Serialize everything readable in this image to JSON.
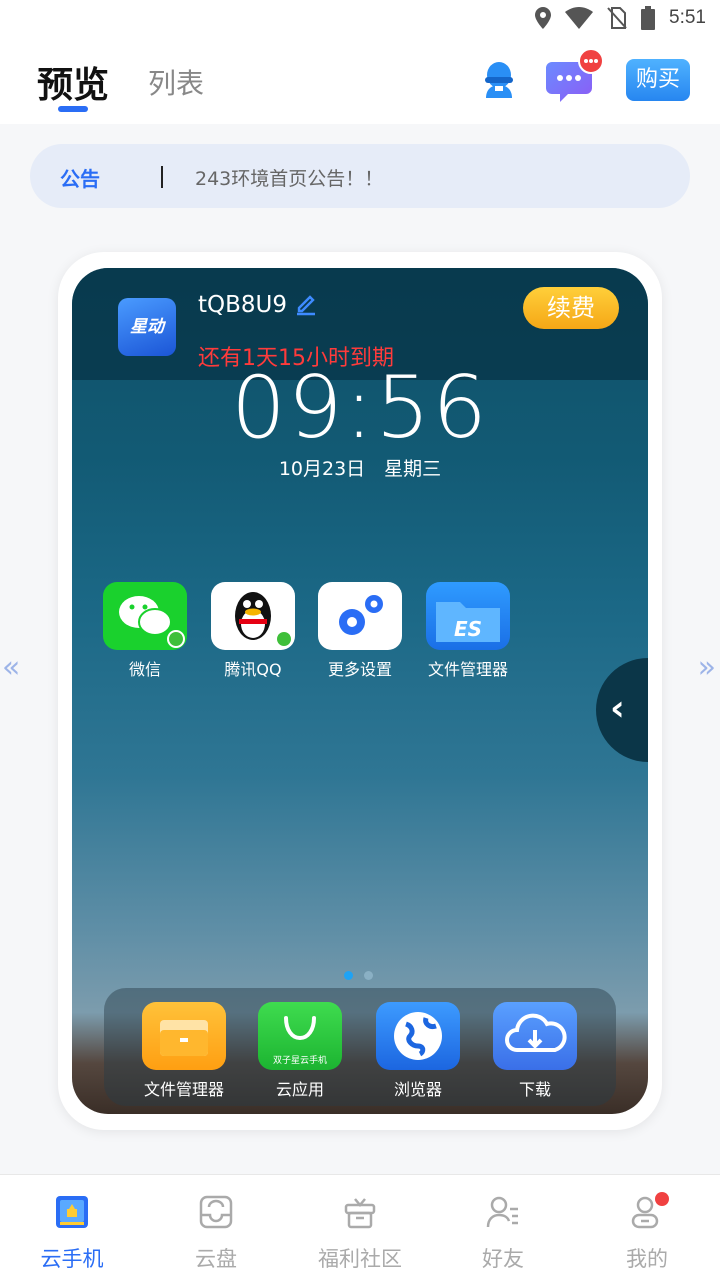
{
  "status_bar": {
    "time": "5:51",
    "icons": [
      "location-icon",
      "wifi-icon",
      "no-sim-icon",
      "battery-icon"
    ]
  },
  "header": {
    "tabs": [
      {
        "label": "预览",
        "active": true
      },
      {
        "label": "列表",
        "active": false
      }
    ],
    "buy_label": "购买"
  },
  "notice": {
    "label": "公告",
    "text": "243环境首页公告！！"
  },
  "device": {
    "logo_text": "星动",
    "name": "tQB8U9",
    "renew_label": "续费",
    "expiry": "还有1天15小时到期",
    "clock": "09:56",
    "date": "10月23日　星期三"
  },
  "home_apps": [
    {
      "label": "微信",
      "icon": "wechat-icon"
    },
    {
      "label": "腾讯QQ",
      "icon": "qq-icon"
    },
    {
      "label": "更多设置",
      "icon": "settings-gears-icon"
    },
    {
      "label": "文件管理器",
      "icon": "es-file-icon"
    }
  ],
  "dock_apps": [
    {
      "label": "文件管理器",
      "icon": "folder-icon"
    },
    {
      "label": "云应用",
      "icon": "cloud-app-icon",
      "caption": "双子星云手机"
    },
    {
      "label": "浏览器",
      "icon": "browser-icon"
    },
    {
      "label": "下载",
      "icon": "cloud-download-icon"
    }
  ],
  "bottom_nav": [
    {
      "label": "云手机",
      "active": true
    },
    {
      "label": "云盘",
      "active": false
    },
    {
      "label": "福利社区",
      "active": false
    },
    {
      "label": "好友",
      "active": false
    },
    {
      "label": "我的",
      "active": false
    }
  ],
  "colors": {
    "accent": "#2a6df5",
    "renew": "#f5a716",
    "expiry": "#ff3b3b",
    "badge": "#f04141"
  }
}
